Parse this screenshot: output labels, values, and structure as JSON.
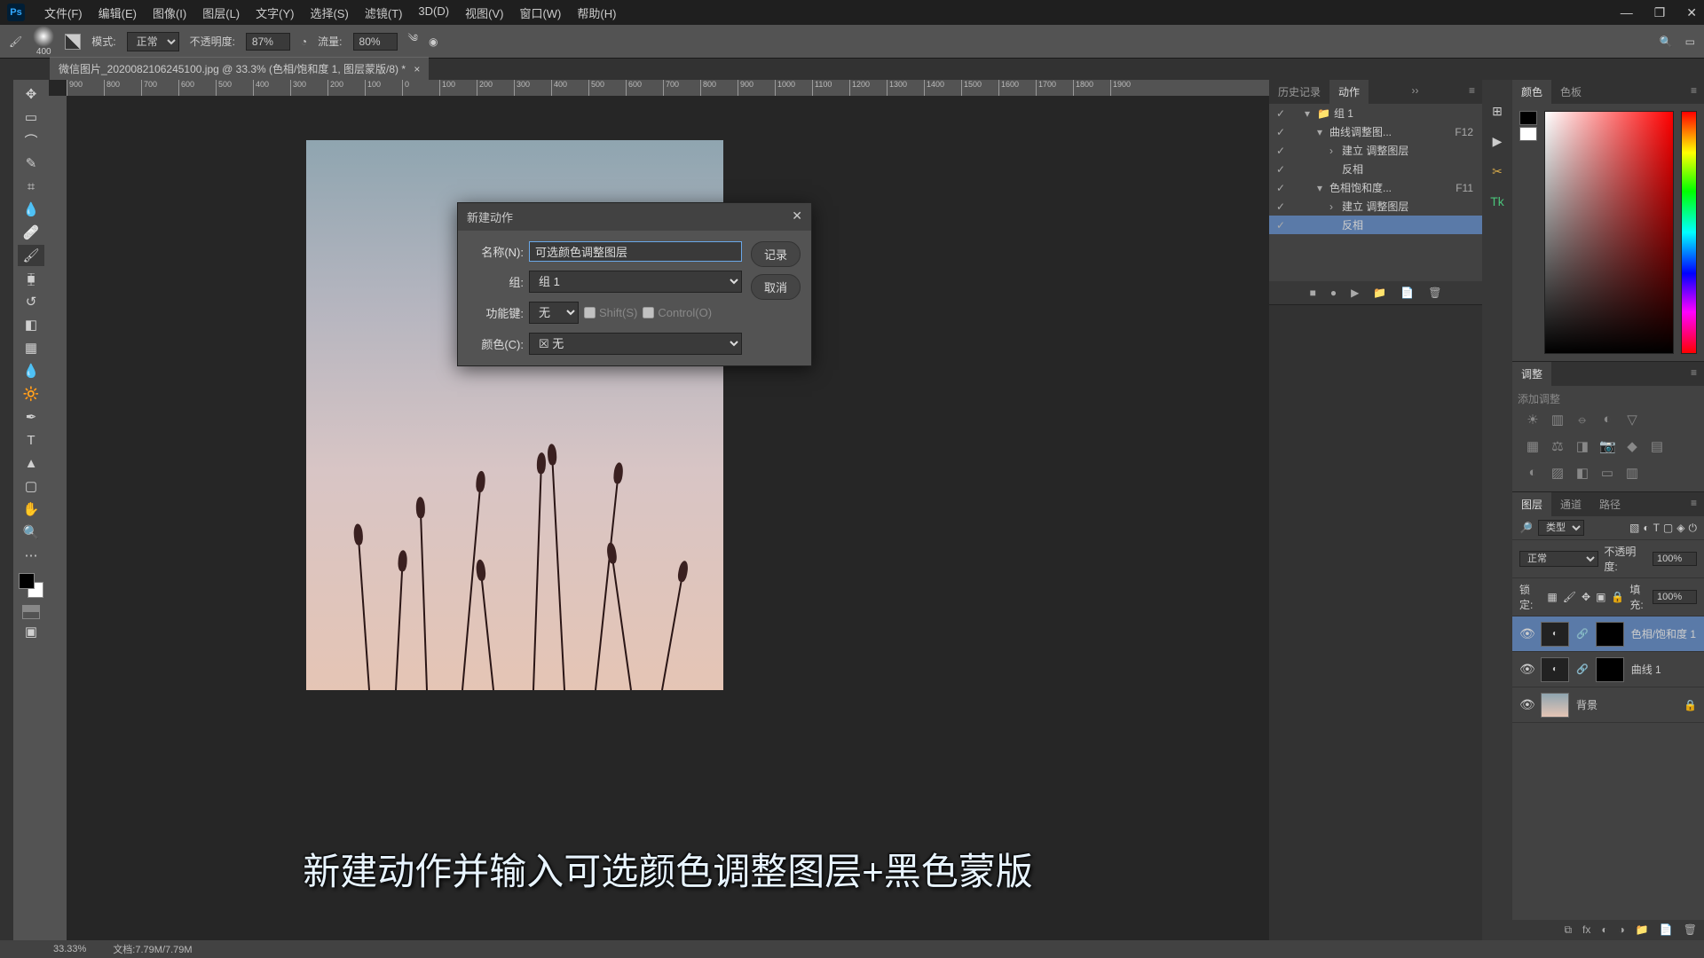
{
  "menu": {
    "file": "文件(F)",
    "edit": "编辑(E)",
    "image": "图像(I)",
    "layer": "图层(L)",
    "type": "文字(Y)",
    "select": "选择(S)",
    "filter": "滤镜(T)",
    "threed": "3D(D)",
    "view": "视图(V)",
    "window": "窗口(W)",
    "help": "帮助(H)"
  },
  "options": {
    "brush_size": "400",
    "mode_label": "模式:",
    "mode_value": "正常",
    "opacity_label": "不透明度:",
    "opacity_value": "87%",
    "flow_label": "流量:",
    "flow_value": "80%"
  },
  "doc": {
    "tab_title": "微信图片_2020082106245100.jpg @ 33.3% (色相/饱和度 1, 图层蒙版/8) *"
  },
  "ruler": [
    "900",
    "800",
    "700",
    "600",
    "500",
    "400",
    "300",
    "200",
    "100",
    "0",
    "100",
    "200",
    "300",
    "400",
    "500",
    "600",
    "700",
    "800",
    "900",
    "1000",
    "1100",
    "1200",
    "1300",
    "1400",
    "1500",
    "1600",
    "1700",
    "1800",
    "1900"
  ],
  "dialog": {
    "title": "新建动作",
    "name_label": "名称(N):",
    "name_value": "可选颜色调整图层",
    "set_label": "组:",
    "set_value": "组 1",
    "fkey_label": "功能键:",
    "fkey_value": "无",
    "shift_label": "Shift(S)",
    "ctrl_label": "Control(O)",
    "color_label": "颜色(C):",
    "color_value": "无",
    "record": "记录",
    "cancel": "取消"
  },
  "actions_panel": {
    "tab_history": "历史记录",
    "tab_actions": "动作",
    "rows": [
      {
        "check": "✓",
        "tw": "▾",
        "indent": 0,
        "folder": true,
        "label": "组 1",
        "fkey": ""
      },
      {
        "check": "✓",
        "tw": "▾",
        "indent": 1,
        "folder": false,
        "label": "曲线调整图...",
        "fkey": "F12"
      },
      {
        "check": "✓",
        "tw": "›",
        "indent": 2,
        "folder": false,
        "label": "建立 调整图层",
        "fkey": ""
      },
      {
        "check": "✓",
        "tw": "",
        "indent": 2,
        "folder": false,
        "label": "反相",
        "fkey": ""
      },
      {
        "check": "✓",
        "tw": "▾",
        "indent": 1,
        "folder": false,
        "label": "色相饱和度...",
        "fkey": "F11"
      },
      {
        "check": "✓",
        "tw": "›",
        "indent": 2,
        "folder": false,
        "label": "建立 调整图层",
        "fkey": ""
      },
      {
        "check": "✓",
        "tw": "",
        "indent": 2,
        "folder": false,
        "label": "反相",
        "fkey": "",
        "sel": true
      }
    ],
    "footer": [
      "■",
      "●",
      "▶",
      "📁",
      "📄",
      "🗑"
    ]
  },
  "color_panel": {
    "tab_color": "颜色",
    "tab_swatch": "色板"
  },
  "adjust_panel": {
    "tab": "调整",
    "hint": "添加调整"
  },
  "layers_panel": {
    "tab_layers": "图层",
    "tab_channels": "通道",
    "tab_paths": "路径",
    "kind_label": "类型",
    "blend": "正常",
    "opacity_label": "不透明度:",
    "opacity": "100%",
    "lock_label": "锁定:",
    "fill_label": "填充:",
    "fill": "100%",
    "layers": [
      {
        "name": "色相/饱和度 1",
        "mask": true,
        "sel": true
      },
      {
        "name": "曲线 1",
        "mask": true,
        "sel": false
      },
      {
        "name": "背景",
        "mask": false,
        "sel": false,
        "locked": true,
        "img": true
      }
    ]
  },
  "caption": "新建动作并输入可选颜色调整图层+黑色蒙版",
  "status": {
    "zoom": "33.33%",
    "docinfo": "文档:7.79M/7.79M"
  }
}
